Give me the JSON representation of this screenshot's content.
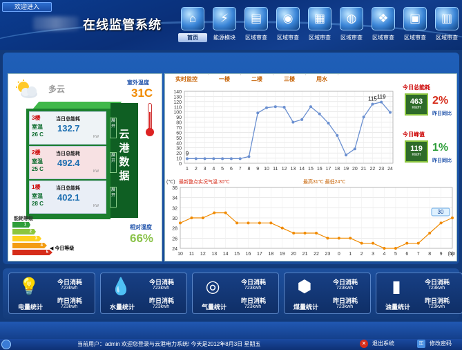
{
  "header": {
    "welcome": "欢迎进入",
    "app_title": "在线监管系统",
    "nav": [
      {
        "label": "首页",
        "icon": "home-icon",
        "glyph": "⌂",
        "active": true
      },
      {
        "label": "能源模块",
        "icon": "energy-module-icon",
        "glyph": "⚡"
      },
      {
        "label": "区域审查",
        "icon": "region-review-icon-1",
        "glyph": "▤"
      },
      {
        "label": "区域审查",
        "icon": "region-review-icon-2",
        "glyph": "◉"
      },
      {
        "label": "区域审查",
        "icon": "region-review-icon-3",
        "glyph": "▦"
      },
      {
        "label": "区域审查",
        "icon": "region-review-icon-4",
        "glyph": "◍"
      },
      {
        "label": "区域审查",
        "icon": "region-review-icon-5",
        "glyph": "❖"
      },
      {
        "label": "区域审查",
        "icon": "region-review-icon-6",
        "glyph": "▣"
      },
      {
        "label": "区域审查",
        "icon": "region-review-icon-7",
        "glyph": "▥"
      }
    ]
  },
  "left": {
    "weather": "多云",
    "outdoor_temp_label": "室外温度",
    "outdoor_temp": "31C",
    "building_name": "云港数据",
    "floors": [
      {
        "num": "3楼",
        "room_label": "室温",
        "room_temp": "26 C",
        "energy_label": "当日总能耗",
        "energy": "132.7",
        "unit": "KW",
        "expand": "展开"
      },
      {
        "num": "2楼",
        "room_label": "室温",
        "room_temp": "25 C",
        "energy_label": "当日总能耗",
        "energy": "492.4",
        "unit": "KW",
        "expand": "展开"
      },
      {
        "num": "1楼",
        "room_label": "室温",
        "room_temp": "28 C",
        "energy_label": "当日总能耗",
        "energy": "402.1",
        "unit": "KW",
        "expand": "展开"
      }
    ],
    "energy_level_title": "能耗等级",
    "levels": [
      "1",
      "2",
      "3",
      "4",
      "5"
    ],
    "level_colors": [
      "#2e9e3a",
      "#8cc63f",
      "#ffd21f",
      "#f39c12",
      "#d62c1a"
    ],
    "today_level": "今日等级",
    "humidity_label": "相对湿度",
    "humidity": "66%"
  },
  "tabs": [
    "实时监控",
    "一楼",
    "二楼",
    "三楼",
    "用水"
  ],
  "kpi": {
    "today_total_label": "今日总能耗",
    "today_total": "463",
    "today_total_unit": "KW/H",
    "today_total_pct": "2%",
    "today_total_sub": "昨日同比",
    "peak_label": "今日峰值",
    "peak": "119",
    "peak_unit": "KW/H",
    "peak_pct": "1%",
    "peak_sub": "昨日同比"
  },
  "chart_data": [
    {
      "type": "line",
      "x": [
        1,
        2,
        3,
        4,
        5,
        6,
        7,
        8,
        9,
        10,
        11,
        12,
        13,
        14,
        15,
        16,
        17,
        18,
        19,
        20,
        21,
        22,
        23,
        24
      ],
      "series": [
        {
          "values": [
            9,
            9,
            9,
            9,
            9,
            9,
            9,
            13,
            98,
            108,
            110,
            109,
            80,
            85,
            110,
            96,
            78,
            54,
            16,
            28,
            90,
            115,
            119,
            99
          ]
        }
      ],
      "ylim": [
        0,
        140
      ],
      "yticks": [
        0,
        10,
        20,
        30,
        40,
        50,
        60,
        70,
        80,
        90,
        100,
        110,
        120,
        130,
        140
      ],
      "point_labels": [
        {
          "x": 1,
          "text": "9"
        },
        {
          "x": 22,
          "text": "115"
        },
        {
          "x": 23,
          "text": "119"
        }
      ],
      "color": "#6a8fd0",
      "grid": true
    },
    {
      "type": "line",
      "categories": [
        "10",
        "11",
        "12",
        "13",
        "14",
        "15",
        "16",
        "17",
        "18",
        "19",
        "20",
        "21",
        "22",
        "23",
        "0",
        "1",
        "2",
        "3",
        "4",
        "5",
        "6",
        "7",
        "8",
        "9",
        "10"
      ],
      "series": [
        {
          "values": [
            29,
            30,
            30,
            31,
            31,
            29,
            29,
            29,
            29,
            28,
            27,
            27,
            27,
            26,
            26,
            26,
            25,
            25,
            24,
            24,
            25,
            25,
            27,
            29,
            30
          ]
        }
      ],
      "ylim": [
        24,
        36
      ],
      "yticks": [
        24,
        26,
        28,
        30,
        32,
        34,
        36
      ],
      "y_unit": "(℃)",
      "x_unit": "(h)",
      "title": "最新整点实况气温:30℃",
      "subtitle": "最高31℃ 最低24℃",
      "callout": "30",
      "color": "#f08a00",
      "grid": true
    }
  ],
  "utilities": [
    {
      "name": "电量统计",
      "icon": "bulb-icon",
      "glyph": "💡",
      "today_label": "今日消耗",
      "today": "723kwh",
      "yesterday_label": "昨日消耗",
      "yesterday": "723kwh"
    },
    {
      "name": "水量统计",
      "icon": "water-drop-icon",
      "glyph": "💧",
      "today_label": "今日消耗",
      "today": "723kwh",
      "yesterday_label": "昨日消耗",
      "yesterday": "723kwh"
    },
    {
      "name": "气量统计",
      "icon": "gas-icon",
      "glyph": "◎",
      "today_label": "今日消耗",
      "today": "723kwh",
      "yesterday_label": "昨日消耗",
      "yesterday": "723kwh"
    },
    {
      "name": "煤量统计",
      "icon": "coal-icon",
      "glyph": "⬢",
      "today_label": "今日消耗",
      "today": "723kwh",
      "yesterday_label": "昨日消耗",
      "yesterday": "723kwh"
    },
    {
      "name": "油量统计",
      "icon": "oil-icon",
      "glyph": "▮",
      "today_label": "今日消耗",
      "today": "723kwh",
      "yesterday_label": "昨日消耗",
      "yesterday": "723kwh"
    }
  ],
  "footer": {
    "status": "当前用户：admin  欢迎您登录与云港电力系统! 今天是2012年8月3日  星期五",
    "logout": "退出系统",
    "change_password": "修改密码"
  }
}
